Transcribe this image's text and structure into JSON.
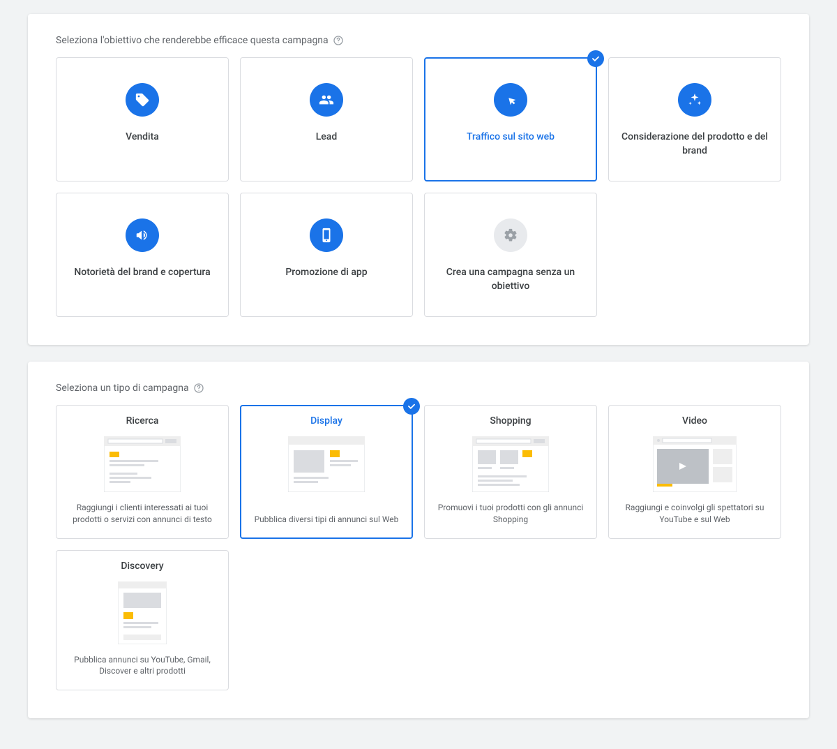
{
  "objective": {
    "header": "Seleziona l'obiettivo che renderebbe efficace questa campagna",
    "cards": [
      {
        "label": "Vendita"
      },
      {
        "label": "Lead"
      },
      {
        "label": "Traffico sul sito web"
      },
      {
        "label": "Considerazione del prodotto e del brand"
      },
      {
        "label": "Notorietà del brand e copertura"
      },
      {
        "label": "Promozione di app"
      },
      {
        "label": "Crea una campagna senza un obiettivo"
      }
    ]
  },
  "campaignType": {
    "header": "Seleziona un tipo di campagna",
    "cards": [
      {
        "title": "Ricerca",
        "desc": "Raggiungi i clienti interessati ai tuoi prodotti o servizi con annunci di testo"
      },
      {
        "title": "Display",
        "desc": "Pubblica diversi tipi di annunci sul Web"
      },
      {
        "title": "Shopping",
        "desc": "Promuovi i tuoi prodotti con gli annunci Shopping"
      },
      {
        "title": "Video",
        "desc": "Raggiungi e coinvolgi gli spettatori su YouTube e sul Web"
      },
      {
        "title": "Discovery",
        "desc": "Pubblica annunci su YouTube, Gmail, Discover e altri prodotti"
      }
    ]
  }
}
